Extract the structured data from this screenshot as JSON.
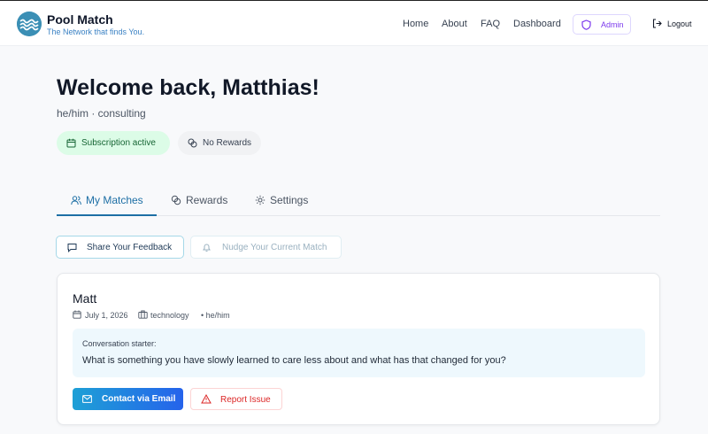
{
  "brand": {
    "title": "Pool Match",
    "tagline": "The Network that finds You.",
    "logo_icon": "wave-logo-icon"
  },
  "nav": {
    "links": [
      "Home",
      "About",
      "FAQ",
      "Dashboard"
    ],
    "admin_label": "Admin",
    "logout_label": "Logout"
  },
  "welcome": {
    "heading": "Welcome back, Matthias!",
    "subline": "he/him · consulting"
  },
  "badges": {
    "subscription": "Subscription active",
    "rewards": "No Rewards"
  },
  "tabs": [
    {
      "label": "My Matches",
      "icon": "users-icon",
      "active": true
    },
    {
      "label": "Rewards",
      "icon": "coins-icon",
      "active": false
    },
    {
      "label": "Settings",
      "icon": "gear-icon",
      "active": false
    }
  ],
  "actions": {
    "feedback_label": "Share Your Feedback",
    "nudge_label": "Nudge Your Current Match"
  },
  "match": {
    "name": "Matt",
    "date": "July 1, 2026",
    "industry": "technology",
    "pronouns": "• he/him",
    "starter_label": "Conversation starter:",
    "starter_question": "What is something you have slowly learned to care less about and what has that changed for you?",
    "contact_label": "Contact via Email",
    "report_label": "Report Issue"
  },
  "colors": {
    "accent": "#1d6fa5",
    "admin": "#7c3aed",
    "subscription_bg": "#dcfce7",
    "danger": "#dc2626"
  }
}
